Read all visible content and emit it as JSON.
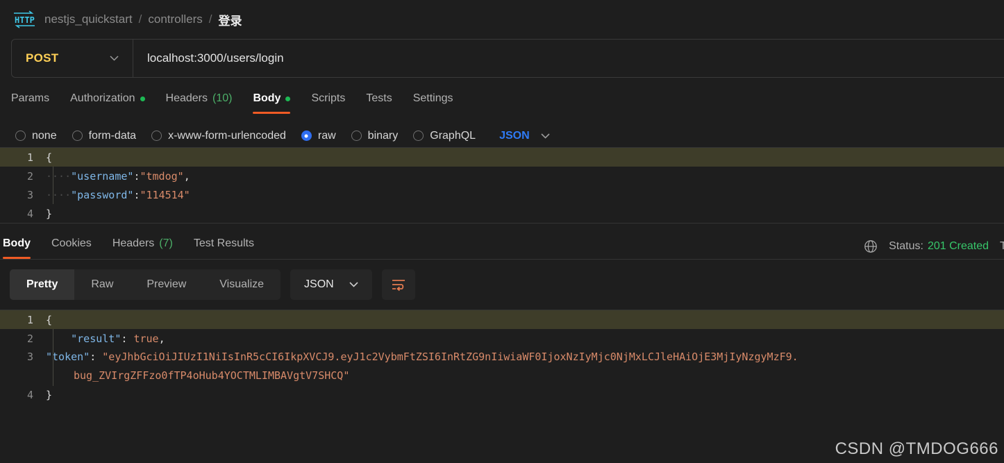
{
  "breadcrumb": {
    "icon": "http-icon",
    "items": [
      {
        "label": "nestjs_quickstart",
        "active": false
      },
      {
        "label": "controllers",
        "active": false
      },
      {
        "label": "登录",
        "active": true
      }
    ],
    "separator": "/"
  },
  "request": {
    "method": "POST",
    "method_color": "#ffd057",
    "url": "localhost:3000/users/login",
    "tabs": [
      {
        "label": "Params",
        "active": false,
        "dot": false,
        "count": null
      },
      {
        "label": "Authorization",
        "active": false,
        "dot": true,
        "count": null
      },
      {
        "label": "Headers",
        "active": false,
        "dot": false,
        "count": "(10)"
      },
      {
        "label": "Body",
        "active": true,
        "dot": true,
        "count": null
      },
      {
        "label": "Scripts",
        "active": false,
        "dot": false,
        "count": null
      },
      {
        "label": "Tests",
        "active": false,
        "dot": false,
        "count": null
      },
      {
        "label": "Settings",
        "active": false,
        "dot": false,
        "count": null
      }
    ],
    "body_options": [
      {
        "label": "none",
        "selected": false
      },
      {
        "label": "form-data",
        "selected": false
      },
      {
        "label": "x-www-form-urlencoded",
        "selected": false
      },
      {
        "label": "raw",
        "selected": true
      },
      {
        "label": "binary",
        "selected": false
      },
      {
        "label": "GraphQL",
        "selected": false
      }
    ],
    "format_selected": "JSON",
    "body_lines": [
      {
        "n": "1",
        "highlight": true,
        "brace": "{"
      },
      {
        "n": "2",
        "highlight": false,
        "indent": "····",
        "key": "\"username\"",
        "colon": ":",
        "value": "\"tmdog\"",
        "tail": ","
      },
      {
        "n": "3",
        "highlight": false,
        "indent": "····",
        "key": "\"password\"",
        "colon": ":",
        "value": "\"114514\"",
        "tail": ""
      },
      {
        "n": "4",
        "highlight": false,
        "brace": "}"
      }
    ]
  },
  "response": {
    "tabs": [
      {
        "label": "Body",
        "active": true,
        "count": null
      },
      {
        "label": "Cookies",
        "active": false,
        "count": null
      },
      {
        "label": "Headers",
        "active": false,
        "count": "(7)"
      },
      {
        "label": "Test Results",
        "active": false,
        "count": null
      }
    ],
    "status_label": "Status:",
    "status_value": "201 Created",
    "status_color": "#37c76a",
    "status_truncated": "T",
    "globe_icon": "globe-icon",
    "view_modes": [
      {
        "label": "Pretty",
        "active": true
      },
      {
        "label": "Raw",
        "active": false
      },
      {
        "label": "Preview",
        "active": false
      },
      {
        "label": "Visualize",
        "active": false
      }
    ],
    "format_selected": "JSON",
    "wrap_icon": "word-wrap-icon",
    "body_lines": [
      {
        "n": "1",
        "highlight": true,
        "brace": "{"
      },
      {
        "n": "2",
        "highlight": false,
        "indent": "    ",
        "key": "\"result\"",
        "colon": ": ",
        "value": "true",
        "value_type": "literal",
        "tail": ","
      },
      {
        "n": "3",
        "highlight": false,
        "indent": "    ",
        "key": "\"token\"",
        "colon": ": ",
        "value": "\"eyJhbGciOiJIUzI1NiIsInR5cCI6IkpXVCJ9.eyJ1c2VybmFtZSI6InRtZG9nIiwiaWF0IjoxNzIyMjc0NjMxLCJleHAiOjE3MjIyNzgyMzF9.",
        "value_wrap": "bug_ZVIrgZFFzo0fTP4oHub4YOCTMLIMBAVgtV7SHCQ\"",
        "value_type": "string",
        "tail": ""
      },
      {
        "n": "4",
        "highlight": false,
        "brace": "}"
      }
    ]
  },
  "watermark": "CSDN @TMDOG666"
}
